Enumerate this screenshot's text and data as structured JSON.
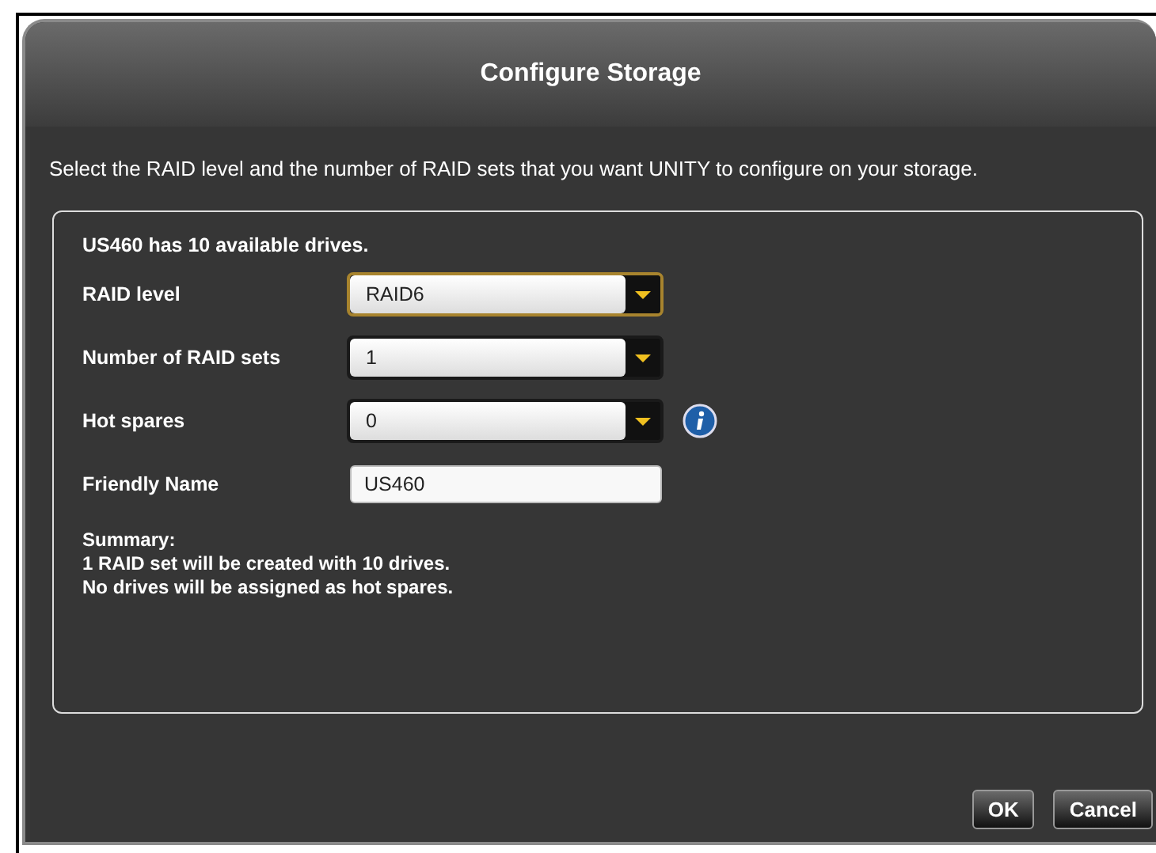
{
  "dialog": {
    "title": "Configure Storage",
    "description": "Select the RAID level and the number of RAID sets that you want UNITY to configure on your storage."
  },
  "panel": {
    "heading": "US460 has 10 available drives.",
    "fields": [
      {
        "kind": "select",
        "label": "RAID level",
        "value": "RAID6",
        "focused": true,
        "info": false
      },
      {
        "kind": "select",
        "label": "Number of RAID sets",
        "value": "1",
        "focused": false,
        "info": false
      },
      {
        "kind": "select",
        "label": "Hot spares",
        "value": "0",
        "focused": false,
        "info": true
      },
      {
        "kind": "text",
        "label": "Friendly Name",
        "value": "US460",
        "focused": false,
        "info": false
      }
    ],
    "summary": [
      "Summary:",
      "1 RAID set will be created with 10 drives.",
      "No drives will be assigned as hot spares."
    ]
  },
  "buttons": [
    "OK",
    "Cancel"
  ]
}
